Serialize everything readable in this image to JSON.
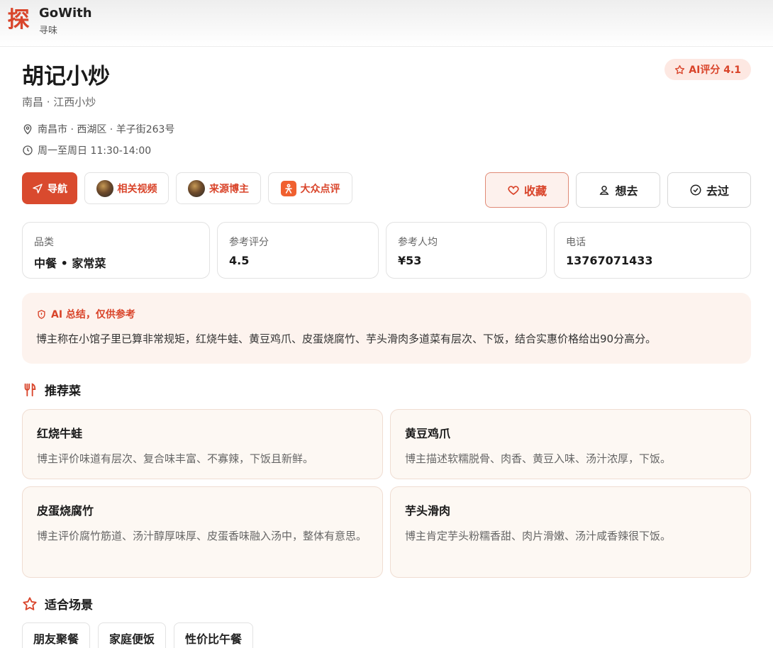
{
  "app": {
    "logo_char": "探",
    "name": "GoWith",
    "subtitle": "寻味"
  },
  "restaurant": {
    "name": "胡记小炒",
    "subtitle": "南昌 · 江西小炒",
    "address": "南昌市 · 西湖区 · 羊子街263号",
    "hours": "周一至周日 11:30-14:00",
    "ai_score": "AI评分 4.1"
  },
  "actions": {
    "nav": "导航",
    "videos": "相关视频",
    "blogger": "来源博主",
    "dianping": "大众点评",
    "favorite": "收藏",
    "want": "想去",
    "been": "去过"
  },
  "info_cards": [
    {
      "label": "品类",
      "value": "中餐 • 家常菜"
    },
    {
      "label": "参考评分",
      "value": "4.5"
    },
    {
      "label": "参考人均",
      "value": "¥53"
    },
    {
      "label": "电话",
      "value": "13767071433"
    }
  ],
  "ai_summary": {
    "title": "AI 总结，仅供参考",
    "text": "博主称在小馆子里已算非常规矩，红烧牛蛙、黄豆鸡爪、皮蛋烧腐竹、芋头滑肉多道菜有层次、下饭，结合实惠价格给出90分高分。"
  },
  "recommended": {
    "title": "推荐菜",
    "dishes": [
      {
        "name": "红烧牛蛙",
        "desc": "博主评价味道有层次、复合味丰富、不寡辣，下饭且新鲜。"
      },
      {
        "name": "黄豆鸡爪",
        "desc": "博主描述软糯脱骨、肉香、黄豆入味、汤汁浓厚，下饭。"
      },
      {
        "name": "皮蛋烧腐竹",
        "desc": "博主评价腐竹筋道、汤汁醇厚味厚、皮蛋香味融入汤中，整体有意思。"
      },
      {
        "name": "芋头滑肉",
        "desc": "博主肯定芋头粉糯香甜、肉片滑嫩、汤汁咸香辣很下饭。"
      }
    ]
  },
  "scenes": {
    "title": "适合场景",
    "tags": [
      "朋友聚餐",
      "家庭便饭",
      "性价比午餐"
    ]
  },
  "colors": {
    "accent": "#d9442a",
    "accent_bg": "#fdf3ee",
    "dish_bg": "#fdf8f3"
  },
  "icons": [
    "location-icon",
    "clock-icon",
    "navigation-icon",
    "heart-icon",
    "user-pin-icon",
    "check-circle-icon",
    "shield-icon",
    "fork-knife-icon",
    "star-icon"
  ]
}
